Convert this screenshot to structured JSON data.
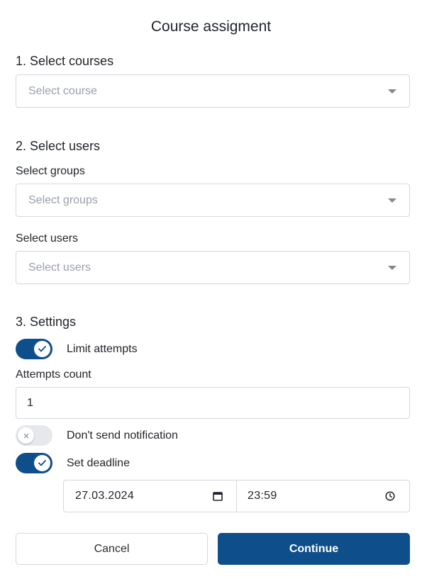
{
  "dialog": {
    "title": "Course assigment"
  },
  "courses": {
    "heading": "1. Select courses",
    "select_placeholder": "Select course"
  },
  "users": {
    "heading": "2. Select users",
    "groups_label": "Select groups",
    "groups_placeholder": "Select groups",
    "users_label": "Select users",
    "users_placeholder": "Select users"
  },
  "settings": {
    "heading": "3. Settings",
    "limit_attempts": {
      "label": "Limit attempts",
      "enabled": true
    },
    "attempts_count": {
      "label": "Attempts count",
      "value": "1"
    },
    "dont_send_notification": {
      "label": "Don't send notification",
      "enabled": false
    },
    "set_deadline": {
      "label": "Set deadline",
      "enabled": true
    },
    "deadline": {
      "date": "27.03.2024",
      "time": "23:59"
    }
  },
  "actions": {
    "cancel_label": "Cancel",
    "continue_label": "Continue"
  },
  "colors": {
    "primary": "#0e4f8b",
    "border": "#d4d7dc",
    "placeholder": "#9aa0a8",
    "toggle_off": "#e6e8eb"
  },
  "icons": {
    "dropdown": "chevron-down-icon",
    "toggle_on": "check-icon",
    "toggle_off": "x-icon",
    "date": "calendar-icon",
    "time": "clock-icon"
  }
}
